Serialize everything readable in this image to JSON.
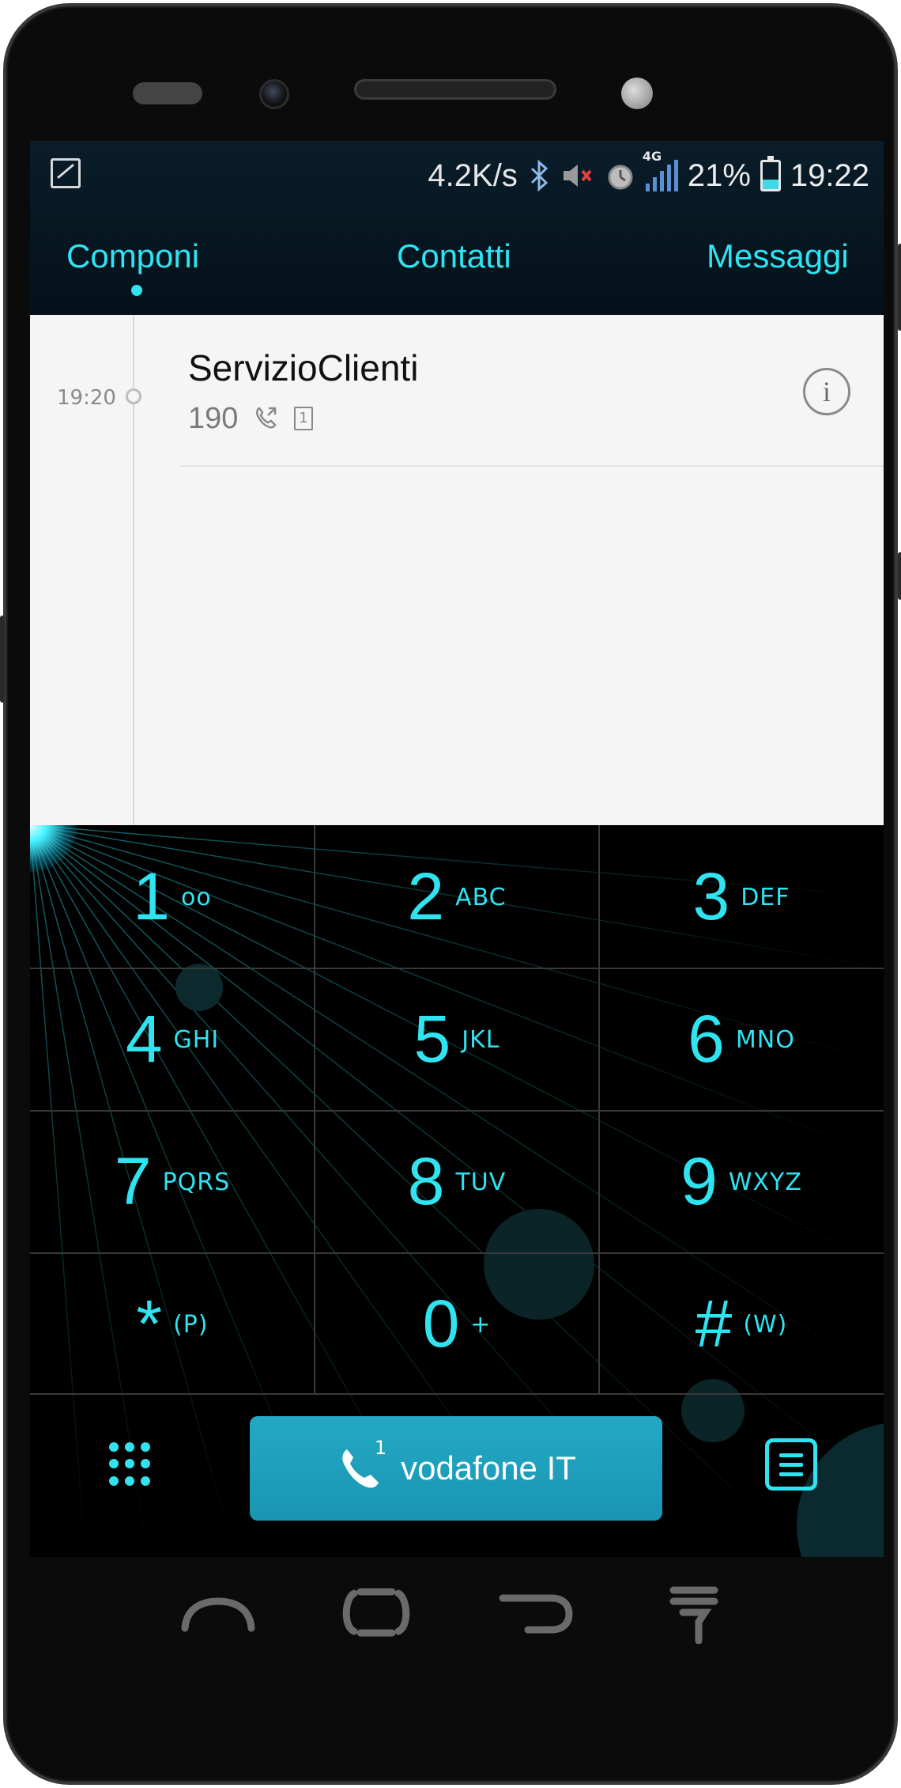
{
  "status_bar": {
    "speed": "4.2K/s",
    "network": "4G",
    "battery_percent": "21%",
    "time": "19:22",
    "icons": [
      "image-icon",
      "bluetooth-icon",
      "mute-icon",
      "alarm-icon",
      "signal-icon",
      "battery-icon"
    ]
  },
  "tabs": [
    {
      "label": "Componi",
      "active": true
    },
    {
      "label": "Contatti",
      "active": false
    },
    {
      "label": "Messaggi",
      "active": false
    }
  ],
  "call_log": [
    {
      "time": "19:20",
      "name": "ServizioClienti",
      "number": "190",
      "sim": "1"
    }
  ],
  "keypad": [
    {
      "digit": "1",
      "letters": "oo"
    },
    {
      "digit": "2",
      "letters": "ABC"
    },
    {
      "digit": "3",
      "letters": "DEF"
    },
    {
      "digit": "4",
      "letters": "GHI"
    },
    {
      "digit": "5",
      "letters": "JKL"
    },
    {
      "digit": "6",
      "letters": "MNO"
    },
    {
      "digit": "7",
      "letters": "PQRS"
    },
    {
      "digit": "8",
      "letters": "TUV"
    },
    {
      "digit": "9",
      "letters": "WXYZ"
    },
    {
      "digit": "*",
      "letters": "(P)"
    },
    {
      "digit": "0",
      "letters": "+"
    },
    {
      "digit": "#",
      "letters": "(W)"
    }
  ],
  "call_button": {
    "label": "vodafone IT",
    "sim": "1"
  },
  "colors": {
    "accent": "#2fe3f0",
    "call_button": "#1f9fbb",
    "log_background": "#f5f5f5"
  }
}
